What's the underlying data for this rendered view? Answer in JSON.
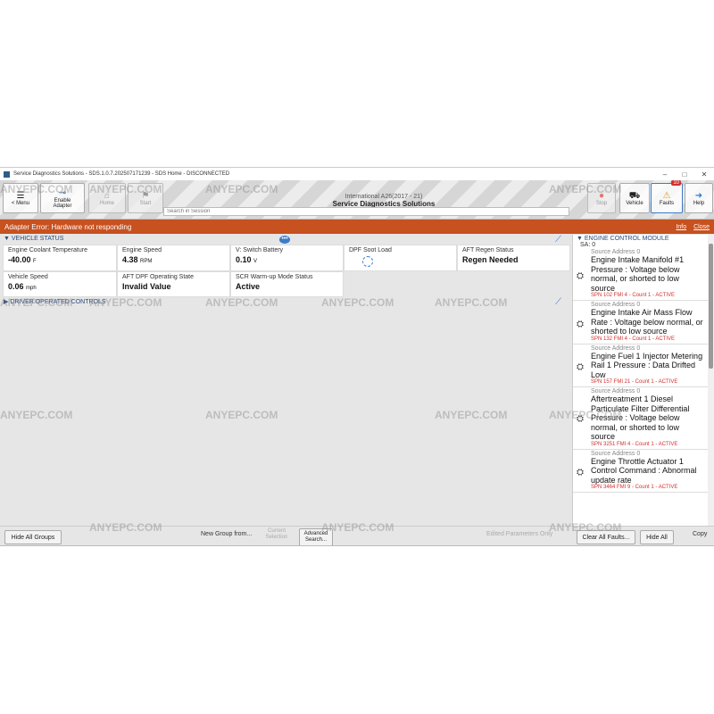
{
  "window": {
    "title": "Service Diagnostics Solutions - SDS.1.0.7.202507171239 - SDS Home - DISCONNECTED",
    "controls": [
      "–",
      "□",
      "✕"
    ]
  },
  "toolbar": {
    "menu_label": "< Menu",
    "enable_adapter_label": "Enable Adapter",
    "home_label": "Home",
    "start_label": "Start",
    "vehicle_model": "International A26(2017 - 21)",
    "app_title": "Service Diagnostics Solutions",
    "search_placeholder": "Search in Session",
    "stop_label": "Stop",
    "vehicle_label": "Vehicle",
    "faults_label": "Faults",
    "faults_count": "10",
    "help_label": "Help"
  },
  "error_bar": {
    "message": "Adapter Error: Hardware not responding",
    "info_label": "Info",
    "close_label": "Close"
  },
  "vehicle_status": {
    "header": "VEHICLE STATUS",
    "params": [
      {
        "label": "Engine Coolant Temperature",
        "value": "-40.00",
        "unit": "F"
      },
      {
        "label": "Engine Speed",
        "value": "4.38",
        "unit": "RPM"
      },
      {
        "label": "V: Switch Battery",
        "value": "0.10",
        "unit": "V"
      },
      {
        "label": "DPF Soot Load",
        "value": "",
        "unit": ""
      },
      {
        "label": "AFT Regen Status",
        "value": "Regen Needed",
        "unit": ""
      },
      {
        "label": "Vehicle Speed",
        "value": "0.06",
        "unit": "mph"
      },
      {
        "label": "AFT DPF Operating State",
        "value": "Invalid Value",
        "unit": ""
      },
      {
        "label": "SCR Warm-up Mode Status",
        "value": "Active",
        "unit": ""
      }
    ]
  },
  "driver_controls": {
    "header": "DRIVER OPERATED CONTROLS"
  },
  "faults_panel": {
    "header": "ENGINE CONTROL MODULE",
    "sa": "SA: 0",
    "items": [
      {
        "source": "Source Address 0",
        "title": "Engine Intake Manifold #1 Pressure : Voltage below normal, or shorted to low source",
        "spn": "SPN 102 FMI 4 - Count 1 - ACTIVE"
      },
      {
        "source": "Source Address 0",
        "title": "Engine Intake Air Mass Flow Rate : Voltage below normal, or shorted to low source",
        "spn": "SPN 132 FMI 4 - Count 1 - ACTIVE"
      },
      {
        "source": "Source Address 0",
        "title": "Engine Fuel 1 Injector Metering Rail 1 Pressure : Data Drifted Low",
        "spn": "SPN 157 FMI 21 - Count 1 - ACTIVE"
      },
      {
        "source": "Source Address 0",
        "title": "Aftertreatment 1 Diesel Particulate Filter Differential Pressure : Voltage below normal, or shorted to low source",
        "spn": "SPN 3251 FMI 4 - Count 1 - ACTIVE"
      },
      {
        "source": "Source Address 0",
        "title": "Engine Throttle Actuator 1 Control Command : Abnormal update rate",
        "spn": "SPN 3464 FMI 9 - Count 1 - ACTIVE"
      }
    ]
  },
  "bottom_bar": {
    "hide_all_groups": "Hide All Groups",
    "new_group": "New Group from...",
    "current_selection": "Current Selection",
    "advanced_search": "Advanced Search...",
    "edited_params": "Edited Parameters Only",
    "clear_all_faults": "Clear All Faults...",
    "hide_all": "Hide All",
    "copy": "Copy"
  },
  "watermark": "ANYEPC.COM",
  "colors": {
    "error_bar": "#c7511f",
    "accent_blue": "#2a4a7a",
    "fault_red": "#d32f2f"
  }
}
